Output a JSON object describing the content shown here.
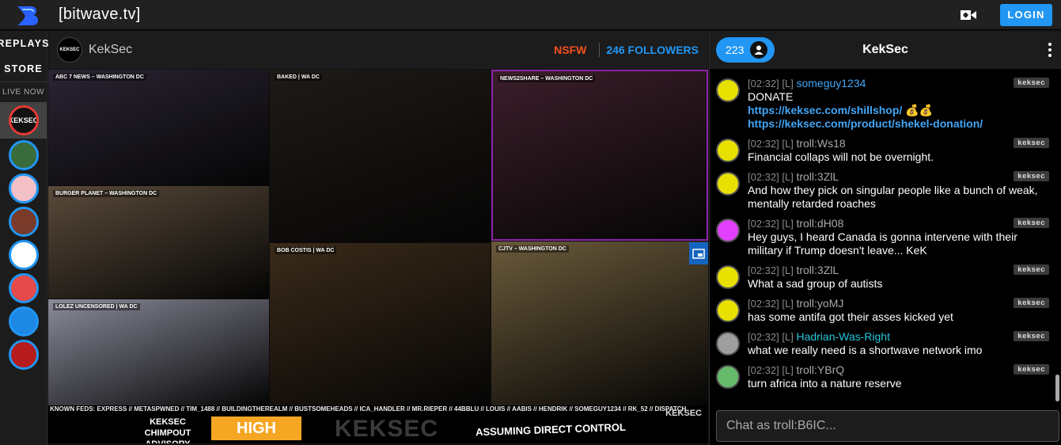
{
  "app": {
    "brand": "[bitwave.tv]",
    "login_label": "LOGIN"
  },
  "colors": {
    "accent": "#2196f3",
    "nsfw": "#f4511e",
    "high_alert": "#f5a623"
  },
  "sidebar": {
    "links": [
      "REPLAYS",
      "STORE"
    ],
    "live_now_label": "LIVE NOW",
    "channels": [
      {
        "label": "KEKSEC",
        "active": true,
        "color": "#111111"
      },
      {
        "label": "",
        "active": false,
        "color": "#3a6b3a"
      },
      {
        "label": "",
        "active": false,
        "color": "#f3c0c8"
      },
      {
        "label": "",
        "active": false,
        "color": "#7a3a2a"
      },
      {
        "label": "",
        "active": false,
        "color": "#ffffff"
      },
      {
        "label": "",
        "active": false,
        "color": "#e64a4a"
      },
      {
        "label": "",
        "active": false,
        "color": "#1e88e5"
      },
      {
        "label": "",
        "active": false,
        "color": "#b71c1c"
      }
    ]
  },
  "stream": {
    "channel_avatar_label": "KEKSEC",
    "channel_name": "KekSec",
    "nsfw_label": "NSFW",
    "followers_label": "246 FOLLOWERS",
    "feeds": [
      {
        "label": "ABC 7 NEWS – WASHINGTON DC",
        "color": "#2a2433"
      },
      {
        "label": "BAKED | WA DC",
        "color": "#1f1a16"
      },
      {
        "label": "NEWS2SHARE – WASHINGTON DC",
        "color": "#3b1e2a"
      },
      {
        "label": "BURGER PLANET – WASHINGTON DC",
        "color": "#5a4a3a"
      },
      {
        "label": "LOLEZ UNCENSORED | WA DC",
        "color": "#8a8a9a"
      },
      {
        "label": "BOB COSTIS | WA DC",
        "color": "#3a2a1a"
      },
      {
        "label": "CJTV – WASHINGTON DC",
        "color": "#6a5a3a"
      }
    ],
    "ticker": "KNOWN FEDS:  EXPRESS  //  METASPWNED  //  TIM_1488  //  BUILDINGTHEREALM  //  BUSTSOMEHEADS  //  ICA_HANDLER  //  MR.RIEPER  //  44BBLU  //  LOUIS  //  AABIS  //  HENDRIK  //  SOMEGUY1234  //  RK_52  //  DISPATCH",
    "advisory_label": "KEKSEC CHIMPOUT ADVISORY SYSTEM",
    "alert_level": "HIGH",
    "watermark": "KEKSEC",
    "direct_control": "ASSUMING DIRECT CONTROL",
    "corner_logo": "KEKSEC"
  },
  "chat": {
    "viewer_count": "223",
    "title": "KekSec",
    "input_placeholder": "Chat as troll:B6IC...",
    "messages": [
      {
        "time": "[02:32] [L]",
        "user": "someguy1234",
        "user_style": "blue",
        "text": "DONATE",
        "links": [
          "https://keksec.com/shillshop/",
          "https://keksec.com/product/shekel-donation/"
        ],
        "tag": "keksec"
      },
      {
        "time": "[02:32] [L]",
        "user": "troll:Ws18",
        "user_style": "gray",
        "text": "Financial collaps will not be overnight.",
        "tag": "keksec"
      },
      {
        "time": "[02:32] [L]",
        "user": "troll:3ZlL",
        "user_style": "gray",
        "text": "And how they pick on singular people like a bunch of weak, mentally retarded roaches",
        "tag": "keksec"
      },
      {
        "time": "[02:32] [L]",
        "user": "troll:dH08",
        "user_style": "gray",
        "text": "Hey guys, I heard Canada is gonna intervene with their military if Trump doesn't leave... KeK",
        "tag": "keksec"
      },
      {
        "time": "[02:32] [L]",
        "user": "troll:3ZlL",
        "user_style": "gray",
        "text": "What a sad group of autists",
        "tag": "keksec"
      },
      {
        "time": "[02:32] [L]",
        "user": "troll:yoMJ",
        "user_style": "gray",
        "text": "has some antifa got their asses kicked yet",
        "tag": "keksec"
      },
      {
        "time": "[02:32] [L]",
        "user": "Hadrian-Was-Right",
        "user_style": "teal",
        "text": "what we really need is a shortwave network imo",
        "tag": "keksec"
      },
      {
        "time": "[02:32] [L]",
        "user": "troll:YBrQ",
        "user_style": "gray",
        "text": "turn africa into a nature reserve",
        "tag": "keksec"
      }
    ]
  }
}
